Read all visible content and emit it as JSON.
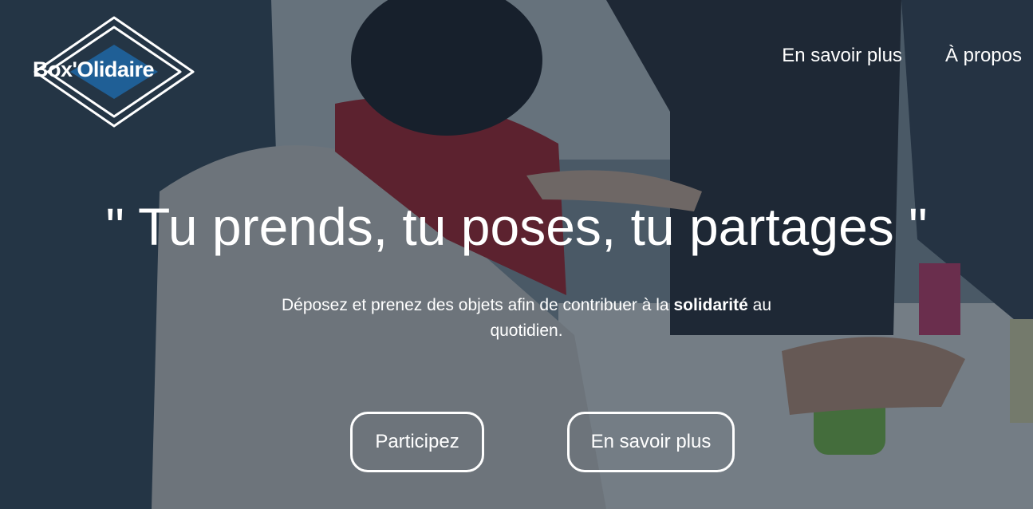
{
  "brand": {
    "logo_text": "Box'Olidaire",
    "logo_accent_color": "#1f5f96"
  },
  "nav": {
    "items": [
      {
        "label": "En savoir plus"
      },
      {
        "label": "À propos"
      }
    ]
  },
  "hero": {
    "headline": "\" Tu prends, tu poses, tu partages \"",
    "subtitle_before": "Déposez et prenez des objets afin de contribuer à la",
    "subtitle_bold": "solidarité",
    "subtitle_after": "au quotidien.",
    "overlay_color": "#14243a"
  },
  "cta": {
    "primary_label": "Participez",
    "secondary_label": "En savoir plus"
  }
}
